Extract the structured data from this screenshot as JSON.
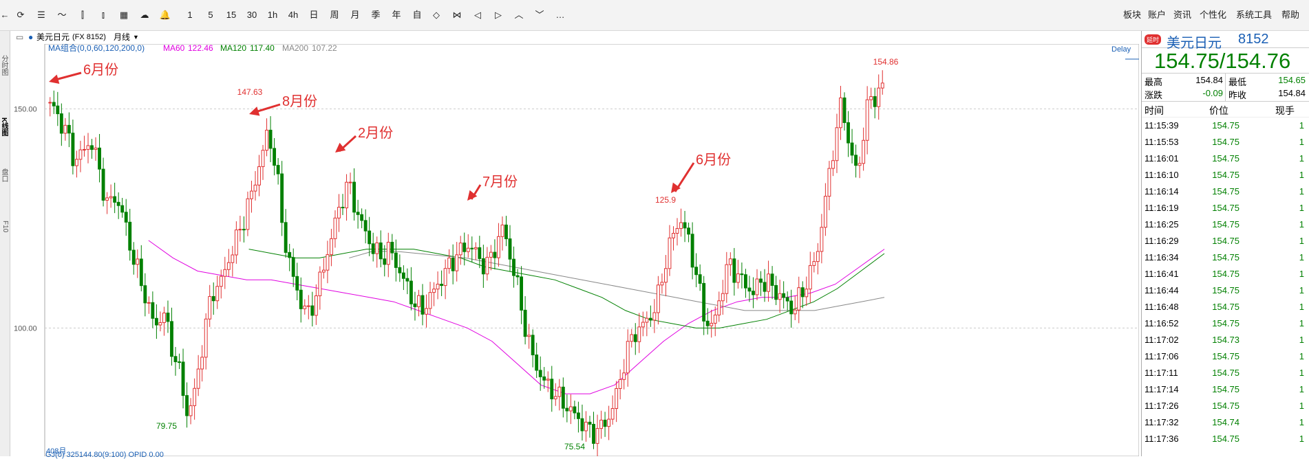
{
  "toolbar": {
    "nav_back_icon": "arrow-left-icon",
    "items": [
      {
        "name": "refresh-icon",
        "label": "",
        "icon": "⟳"
      },
      {
        "name": "list-icon",
        "label": "",
        "icon": "☰"
      },
      {
        "name": "line-chart-icon",
        "label": "",
        "icon": "〜"
      },
      {
        "name": "candlestick-icon",
        "label": "",
        "icon": "⫿"
      },
      {
        "name": "bar-chart-icon",
        "label": "",
        "icon": "⫾"
      },
      {
        "name": "grid-icon",
        "label": "",
        "icon": "▦"
      },
      {
        "name": "cloud-icon",
        "label": "",
        "icon": "☁"
      },
      {
        "name": "bell-icon",
        "label": "",
        "icon": "🔔"
      }
    ],
    "periods": [
      "1",
      "5",
      "15",
      "30",
      "1h",
      "4h",
      "日",
      "周",
      "月",
      "季",
      "年",
      "自"
    ],
    "tools": [
      {
        "name": "zoom-in-icon",
        "icon": "◇"
      },
      {
        "name": "zoom-out-icon",
        "icon": "⋈"
      },
      {
        "name": "move-left-icon",
        "icon": "◁"
      },
      {
        "name": "move-right-icon",
        "icon": "▷"
      },
      {
        "name": "expand-up-icon",
        "icon": "︿"
      },
      {
        "name": "expand-down-icon",
        "icon": "﹀"
      },
      {
        "name": "more-icon",
        "icon": "…"
      }
    ],
    "right_menu": [
      "板块",
      "账户",
      "资讯",
      "个性化",
      "系统工具",
      "帮助"
    ]
  },
  "left_tabs": [
    "分时图",
    "K线图",
    "盘口",
    "F10"
  ],
  "sub_bar": {
    "symbol": "美元日元",
    "code": "(FX 8152)",
    "period": "月线"
  },
  "ma_bar": {
    "combo": "MA组合(0,0,60,120,200,0)",
    "ma60_label": "MA60",
    "ma60_value": "122.46",
    "ma120_label": "MA120",
    "ma120_value": "117.40",
    "ma200_label": "MA200",
    "ma200_value": "107.22",
    "delay": "Delay"
  },
  "chart_data": {
    "type": "candlestick",
    "y_axis_ticks": [
      150.0,
      100.0
    ],
    "ylim": [
      72,
      162
    ],
    "date_label": "408月",
    "high_label": "154.86",
    "price_labels": [
      {
        "text": "147.63"
      },
      {
        "text": "125.9"
      },
      {
        "text": "79.75"
      },
      {
        "text": "75.54"
      }
    ],
    "annotations": [
      {
        "text": "6月份"
      },
      {
        "text": "8月份"
      },
      {
        "text": "2月份"
      },
      {
        "text": "7月份"
      },
      {
        "text": "6月份"
      }
    ],
    "close_path": [
      151.5,
      148,
      145,
      138,
      140,
      143,
      137,
      128,
      130,
      126,
      118,
      112,
      106,
      100,
      104,
      96,
      90,
      80,
      86,
      98,
      108,
      110,
      115,
      120,
      125,
      131,
      138,
      145,
      136,
      120,
      112,
      106,
      103,
      108,
      115,
      122,
      129,
      133,
      126,
      122,
      118,
      116,
      118,
      114,
      110,
      106,
      104,
      107,
      110,
      113,
      116,
      118,
      119,
      116,
      114,
      118,
      123,
      116,
      108,
      98,
      92,
      88,
      86,
      84,
      82,
      80,
      78,
      76,
      77,
      79,
      84,
      92,
      98,
      100,
      102,
      105,
      114,
      121,
      125,
      120,
      112,
      102,
      100,
      108,
      115,
      112,
      110,
      108,
      111,
      110,
      108,
      106,
      104,
      108,
      112,
      118,
      130,
      142,
      152,
      140,
      135,
      150,
      153,
      154.75
    ],
    "ma60_path": [
      120,
      116,
      113,
      112,
      111,
      111,
      110,
      109,
      108,
      107,
      106,
      104,
      102,
      100,
      97,
      92,
      87,
      85,
      85,
      87,
      92,
      97,
      101,
      104,
      106,
      107,
      107,
      108,
      110,
      114,
      118
    ],
    "ma120_path": [
      118,
      117,
      116,
      116,
      117,
      118,
      118,
      118,
      117,
      116,
      114,
      113,
      112,
      111,
      109,
      107,
      104,
      102,
      101,
      100,
      100,
      101,
      102,
      104,
      106,
      109,
      113,
      117
    ],
    "ma200_path": [
      116,
      117.5,
      117.5,
      117,
      116.5,
      116,
      115,
      114,
      113,
      112,
      111,
      110,
      109,
      108,
      107,
      106,
      105,
      104,
      104,
      104,
      104,
      105,
      106,
      107
    ]
  },
  "bottom_bar": {
    "text": "GJ(0)  325144.80(9:100)  OPID 0.00"
  },
  "quote_panel": {
    "badge": "延时",
    "name": "美元日元",
    "code": "8152",
    "price": "154.75/154.76",
    "high_label": "最高",
    "high_value": "154.84",
    "low_label": "最低",
    "low_value": "154.65",
    "change_label": "涨跌",
    "change_value": "-0.09",
    "prev_label": "昨收",
    "prev_value": "154.84",
    "trades_header": {
      "time": "时间",
      "price": "价位",
      "volume": "现手"
    },
    "trades": [
      {
        "time": "11:15:39",
        "price": "154.75",
        "vol": "1"
      },
      {
        "time": "11:15:53",
        "price": "154.75",
        "vol": "1"
      },
      {
        "time": "11:16:01",
        "price": "154.75",
        "vol": "1"
      },
      {
        "time": "11:16:10",
        "price": "154.75",
        "vol": "1"
      },
      {
        "time": "11:16:14",
        "price": "154.75",
        "vol": "1"
      },
      {
        "time": "11:16:19",
        "price": "154.75",
        "vol": "1"
      },
      {
        "time": "11:16:25",
        "price": "154.75",
        "vol": "1"
      },
      {
        "time": "11:16:29",
        "price": "154.75",
        "vol": "1"
      },
      {
        "time": "11:16:34",
        "price": "154.75",
        "vol": "1"
      },
      {
        "time": "11:16:41",
        "price": "154.75",
        "vol": "1"
      },
      {
        "time": "11:16:44",
        "price": "154.75",
        "vol": "1"
      },
      {
        "time": "11:16:48",
        "price": "154.75",
        "vol": "1"
      },
      {
        "time": "11:16:52",
        "price": "154.75",
        "vol": "1"
      },
      {
        "time": "11:17:02",
        "price": "154.73",
        "vol": "1"
      },
      {
        "time": "11:17:06",
        "price": "154.75",
        "vol": "1"
      },
      {
        "time": "11:17:11",
        "price": "154.75",
        "vol": "1"
      },
      {
        "time": "11:17:14",
        "price": "154.75",
        "vol": "1"
      },
      {
        "time": "11:17:26",
        "price": "154.75",
        "vol": "1"
      },
      {
        "time": "11:17:32",
        "price": "154.74",
        "vol": "1"
      },
      {
        "time": "11:17:36",
        "price": "154.75",
        "vol": "1"
      }
    ],
    "colors": {
      "up": "#e03030",
      "down": "#008000",
      "ma60": "#e000e0",
      "ma120": "#008000",
      "ma200": "#888888",
      "accent": "#1a5fb4"
    }
  }
}
